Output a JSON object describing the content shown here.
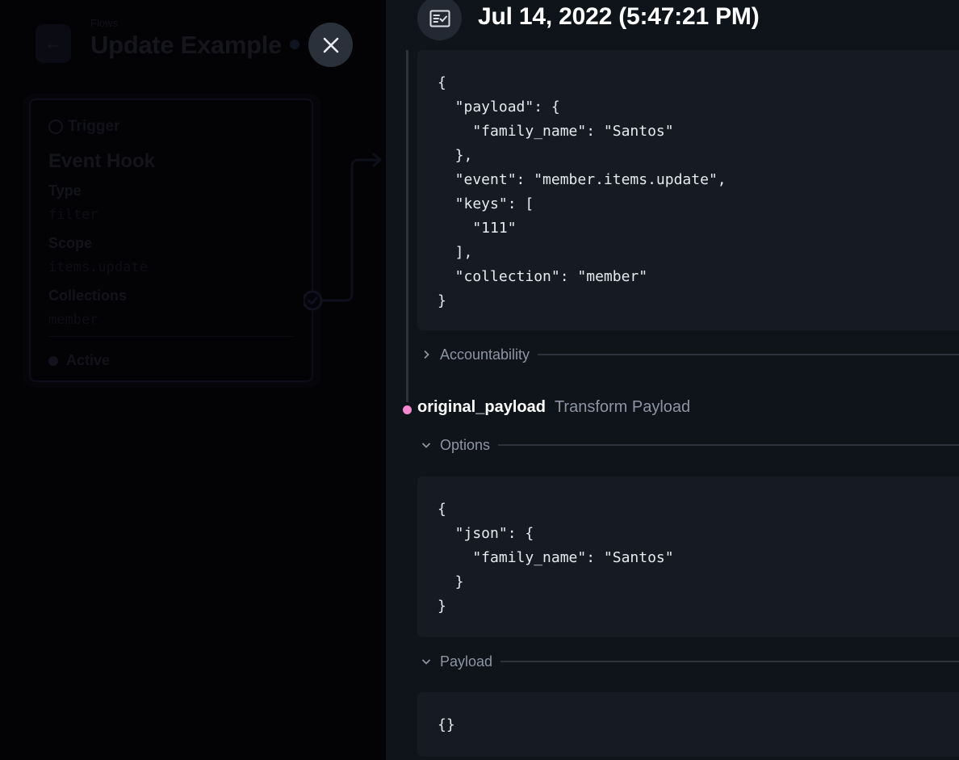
{
  "background": {
    "breadcrumb": "Flows",
    "flow_title": "Update Example",
    "trigger_card": {
      "header": "Trigger",
      "name": "Event Hook",
      "type_label": "Type",
      "type_value": "filter",
      "scope_label": "Scope",
      "scope_value": "items.update",
      "collections_label": "Collections",
      "collections_value": "member",
      "status": "Active"
    }
  },
  "drawer": {
    "title": "Jul 14, 2022 (5:47:21 PM)",
    "trigger_payload": "{\n  \"payload\": {\n    \"family_name\": \"Santos\"\n  },\n  \"event\": \"member.items.update\",\n  \"keys\": [\n    \"111\"\n  ],\n  \"collection\": \"member\"\n}",
    "accountability_label": "Accountability",
    "operation": {
      "key": "original_payload",
      "type": "Transform Payload",
      "dot_color": "#f38ad1"
    },
    "options_label": "Options",
    "options_json": "{\n  \"json\": {\n    \"family_name\": \"Santos\"\n  }\n}",
    "payload_label": "Payload",
    "payload_json": "{}"
  },
  "icons": {
    "close": "close-icon",
    "header": "checklist-icon",
    "back": "arrow-left-icon"
  }
}
